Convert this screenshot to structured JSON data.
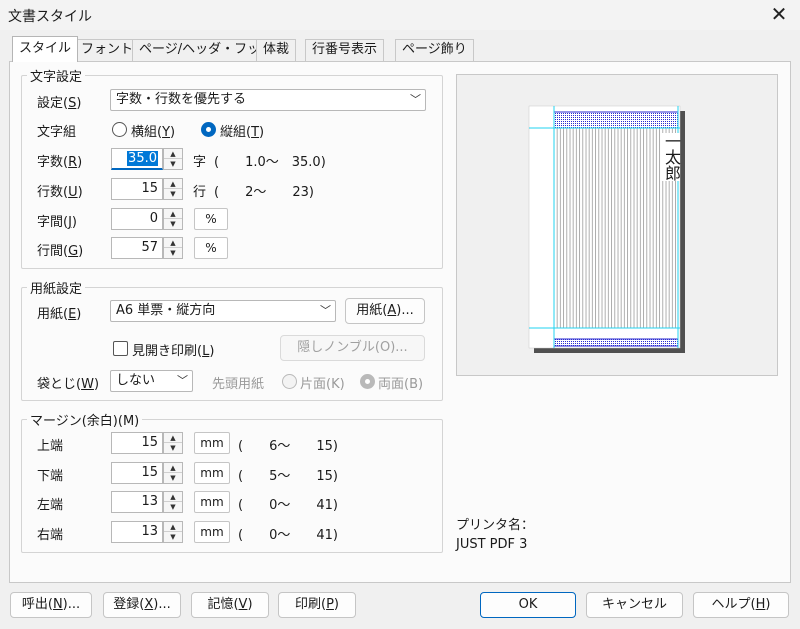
{
  "window": {
    "title": "文書スタイル",
    "close_glyph": "✕"
  },
  "tabs": [
    {
      "label": "スタイル",
      "active": true
    },
    {
      "label": "フォント"
    },
    {
      "label": "ページ/ヘッダ・フッタ"
    },
    {
      "label": "体裁"
    },
    {
      "label": "行番号表示"
    },
    {
      "label": "ページ飾り"
    }
  ],
  "moji": {
    "group_title": "文字設定",
    "setting_label": "設定(",
    "setting_key": "S",
    "setting_value": "字数・行数を優先する",
    "gumi_label": "文字組",
    "yoko_label": "横組(",
    "yoko_key": "Y",
    "tate_label": "縦組(",
    "tate_key": "T",
    "close_paren": ")",
    "jisu_label": "字数(",
    "jisu_key": "R",
    "jisu_value": "35.0",
    "jisu_unit": "字",
    "jisu_range": "(　　1.0～　35.0)",
    "gyosu_label": "行数(",
    "gyosu_key": "U",
    "gyosu_value": "15",
    "gyosu_unit": "行",
    "gyosu_range": "(　　2～　　23)",
    "jikan_label": "字間(",
    "jikan_key": "J",
    "jikan_value": "0",
    "jikan_unit": "%",
    "gyokan_label": "行間(",
    "gyokan_key": "G",
    "gyokan_value": "57",
    "gyokan_unit": "%"
  },
  "paper": {
    "group_title": "用紙設定",
    "paper_label": "用紙(",
    "paper_key": "E",
    "paper_value": "A6 単票・縦方向",
    "paper_button": "用紙(",
    "paper_button_key": "A",
    "paper_button_suffix": ")...",
    "mihiraki_label": "見開き印刷(",
    "mihiraki_key": "L",
    "nombre_button": "隠しノンブル(O)...",
    "fukuro_label": "袋とじ(",
    "fukuro_key": "W",
    "fukuro_value": "しない",
    "sento_label": "先頭用紙",
    "katamen_label": "片面(K)",
    "ryomen_label": "両面(B)"
  },
  "margin": {
    "group_title": "マージン(余白)(M)",
    "unit": "mm",
    "rows": [
      {
        "label": "上端",
        "value": "15",
        "range": "(　　6～　　15)"
      },
      {
        "label": "下端",
        "value": "15",
        "range": "(　　5～　　15)"
      },
      {
        "label": "左端",
        "value": "13",
        "range": "(　　0～　　41)"
      },
      {
        "label": "右端",
        "value": "13",
        "range": "(　　0～　　41)"
      }
    ]
  },
  "preview": {
    "sample_text": "一太郎"
  },
  "printer": {
    "label": "プリンタ名：",
    "value": "JUST PDF 3"
  },
  "footer": {
    "yobidashi": "呼出(",
    "yobidashi_key": "N",
    "toroku": "登録(",
    "toroku_key": "X",
    "kioku": "記憶(",
    "kioku_key": "V",
    "insatsu": "印刷(",
    "insatsu_key": "P",
    "ellipsis_close": ")...",
    "close_only": ")",
    "ok": "OK",
    "cancel": "キャンセル",
    "help": "ヘルプ(",
    "help_key": "H"
  },
  "colors": {
    "accent": "#0067c0",
    "preview_band": "#2a2ad0",
    "guide_line": "#22d3f0"
  }
}
